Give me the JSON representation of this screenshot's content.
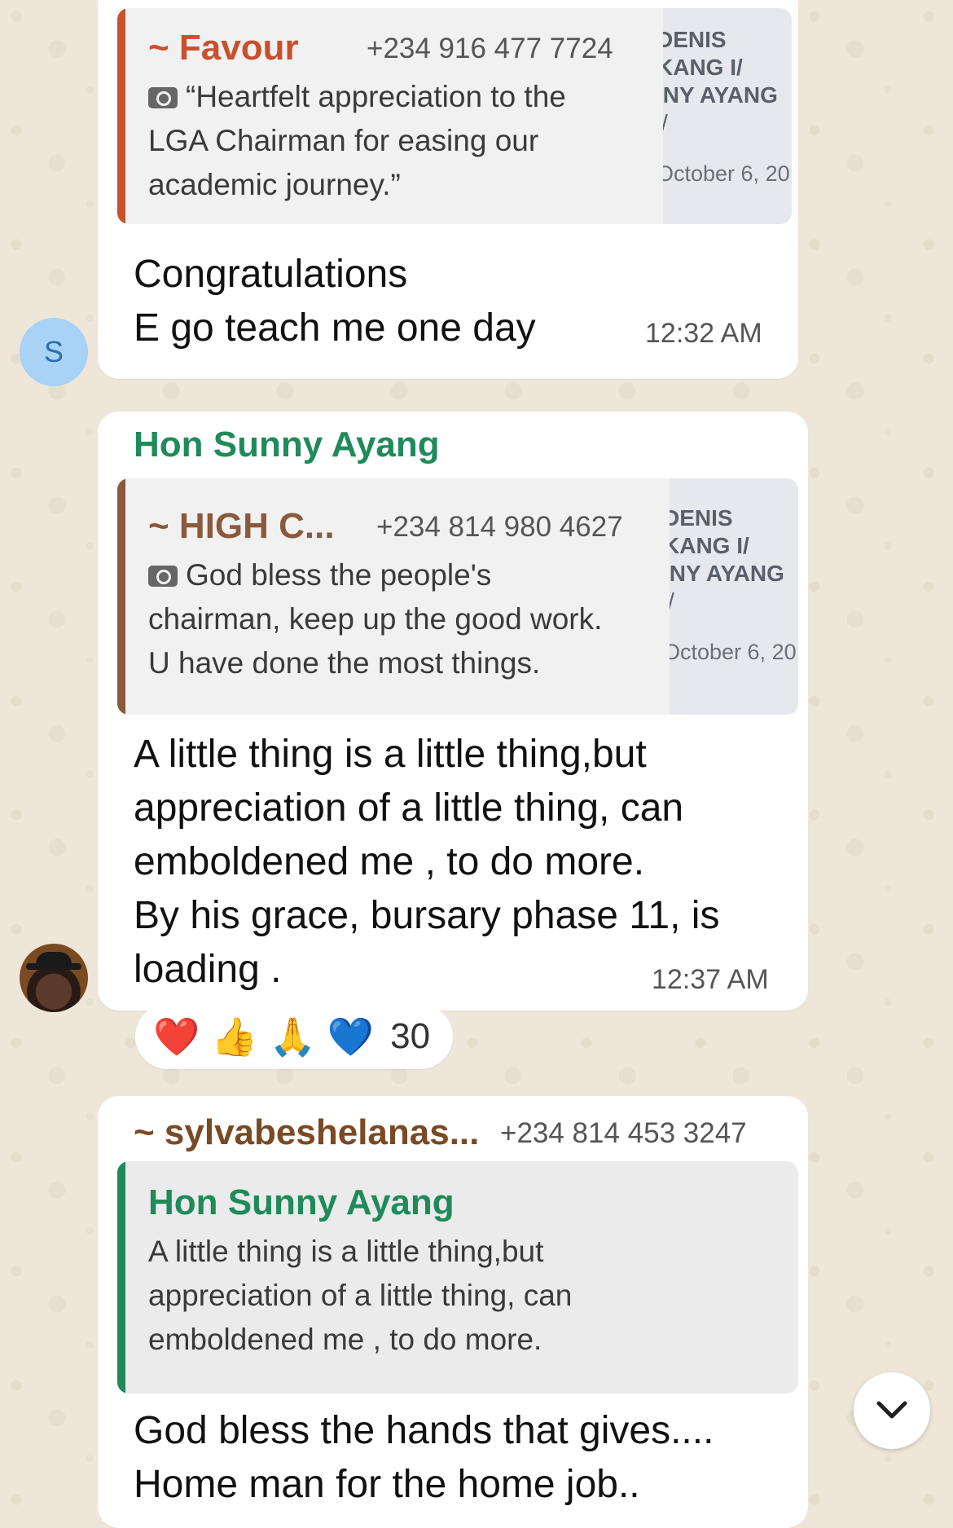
{
  "messages": [
    {
      "reply": {
        "name": "~ Favour",
        "phone": "+234 916 477 7724",
        "text": "“Heartfelt appreciation to the\nLGA Chairman for easing our\nacademic journey.”",
        "thumb_lines": [
          "DENIS",
          "KANG I/",
          "INY AYANG",
          "/"
        ],
        "thumb_date": "October 6, 20"
      },
      "text": "Congratulations\n E go teach me one day",
      "time": "12:32 AM",
      "avatar_letter": "S"
    },
    {
      "sender": "Hon Sunny Ayang",
      "reply": {
        "name": "~ HIGH C...",
        "phone": "+234 814 980 4627",
        "text": "God bless the people's\nchairman, keep up the good work.\nU have done the most things.",
        "thumb_lines": [
          "DENIS",
          "KANG I/",
          "INY AYANG",
          "/"
        ],
        "thumb_date": "October 6, 20"
      },
      "text": "A little thing is a little thing,but\nappreciation of a little thing, can\nemboldened me , to do more.\n By his grace, bursary phase 11, is\nloading .",
      "time": "12:37 AM",
      "reactions": {
        "emojis": [
          "❤️",
          "👍",
          "🙏",
          "💙"
        ],
        "count": "30"
      }
    },
    {
      "sender": "~ sylvabeshelanas...",
      "phone": "+234 814 453 3247",
      "reply": {
        "name": "Hon Sunny Ayang",
        "text": "A little thing is a little thing,but\nappreciation of a little thing, can\nemboldened me , to do more."
      },
      "text": "God bless the hands that gives....\nHome  man for the home job.."
    }
  ],
  "colors": {
    "favour": "#c8502b",
    "high_c": "#8a5a3c",
    "sunny": "#1f8a5a",
    "sylva": "#7a4a24"
  },
  "icons": {
    "camera": "camera-icon",
    "scroll": "chevron-down-icon"
  }
}
